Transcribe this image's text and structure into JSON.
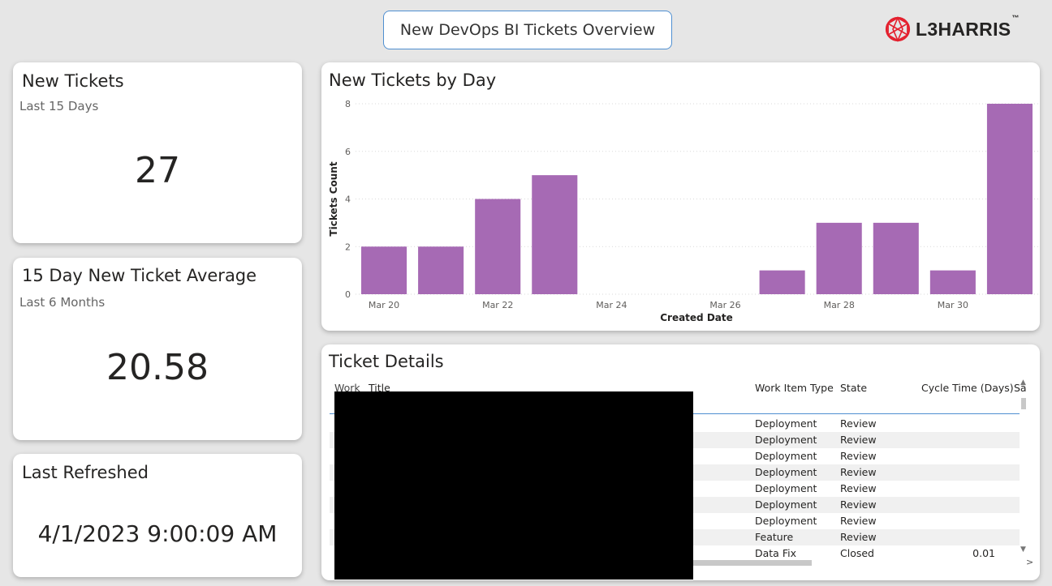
{
  "header": {
    "title": "New DevOps BI Tickets Overview",
    "logo_text": "L3HARRIS",
    "logo_tm": "™"
  },
  "kpi_new_tickets": {
    "title": "New Tickets",
    "subtitle": "Last 15 Days",
    "value": "27"
  },
  "kpi_average": {
    "title": "15 Day New Ticket Average",
    "subtitle": "Last 6 Months",
    "value": "20.58"
  },
  "last_refreshed": {
    "title": "Last Refreshed",
    "value": "4/1/2023 9:00:09 AM"
  },
  "chart_panel": {
    "title": "New Tickets by Day"
  },
  "chart_data": {
    "type": "bar",
    "title": "New Tickets by Day",
    "xlabel": "Created Date",
    "ylabel": "Tickets Count",
    "ylim": [
      0,
      8
    ],
    "yticks": [
      0,
      2,
      4,
      6,
      8
    ],
    "x_tick_labels": [
      "Mar 20",
      "Mar 22",
      "Mar 24",
      "Mar 26",
      "Mar 28",
      "Mar 30"
    ],
    "categories": [
      "Mar 20",
      "Mar 21",
      "Mar 22",
      "Mar 23",
      "Mar 24",
      "Mar 25",
      "Mar 26",
      "Mar 27",
      "Mar 28",
      "Mar 29",
      "Mar 30",
      "Mar 31"
    ],
    "values": [
      2,
      2,
      4,
      5,
      0,
      0,
      0,
      1,
      3,
      3,
      1,
      8
    ],
    "bar_color": "#a66ab4",
    "grid": true
  },
  "table_panel": {
    "title": "Ticket Details",
    "columns": {
      "work_item_id": "Work Item ID",
      "title": "Title",
      "work_item_type": "Work Item Type",
      "state": "State",
      "cycle_time": "Cycle Time (Days)",
      "sa": "Sa"
    },
    "rows": [
      {
        "type": "Deployment",
        "state": "Review",
        "cycle": ""
      },
      {
        "type": "Deployment",
        "state": "Review",
        "cycle": ""
      },
      {
        "type": "Deployment",
        "state": "Review",
        "cycle": ""
      },
      {
        "type": "Deployment",
        "state": "Review",
        "cycle": ""
      },
      {
        "type": "Deployment",
        "state": "Review",
        "cycle": ""
      },
      {
        "type": "Deployment",
        "state": "Review",
        "cycle": ""
      },
      {
        "type": "Deployment",
        "state": "Review",
        "cycle": ""
      },
      {
        "type": "Feature",
        "state": "Review",
        "cycle": ""
      },
      {
        "type": "Data Fix",
        "state": "Closed",
        "cycle": "0.01"
      }
    ]
  },
  "colors": {
    "accent": "#a66ab4",
    "title_border": "#4f8fd1",
    "logo_red": "#e4202e"
  }
}
